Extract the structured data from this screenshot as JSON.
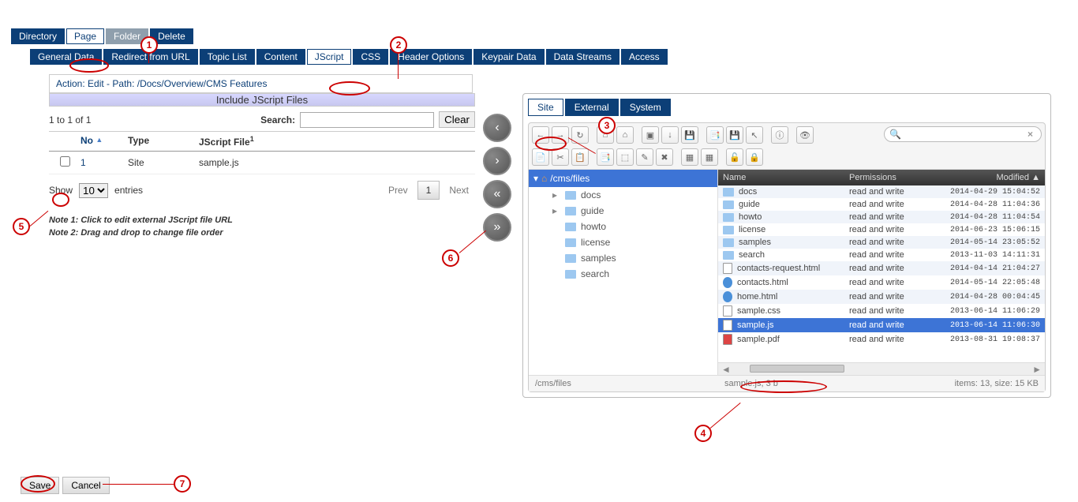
{
  "top_tabs": {
    "directory": "Directory",
    "page": "Page",
    "folder": "Folder",
    "delete": "Delete"
  },
  "sub_tabs": [
    "General Data",
    "Redirect from URL",
    "Topic List",
    "Content",
    "JScript",
    "CSS",
    "Header Options",
    "Keypair Data",
    "Data Streams",
    "Access"
  ],
  "sub_tab_selected": 4,
  "action_bar": {
    "prefix": "Action: ",
    "action": "Edit",
    "sep": " - ",
    "path_label": "Path: ",
    "path": "/Docs/Overview/CMS Features"
  },
  "section_title": "Include JScript Files",
  "search": {
    "count": "1 to 1 of 1",
    "label": "Search:",
    "value": "",
    "clear": "Clear"
  },
  "grid": {
    "headers": {
      "no": "No",
      "type": "Type",
      "file": "JScript File",
      "file_sup": "1"
    },
    "rows": [
      {
        "no": "1",
        "type": "Site",
        "file": "sample.js",
        "checked": false
      }
    ]
  },
  "pager": {
    "show": "Show",
    "entries": "entries",
    "size": "10",
    "prev": "Prev",
    "page": "1",
    "next": "Next"
  },
  "notes": {
    "n1": "Note 1: Click to edit external JScript file URL",
    "n2": "Note 2: Drag and drop to change file order"
  },
  "rp_tabs": [
    "Site",
    "External",
    "System"
  ],
  "rp_tab_selected": 0,
  "fm": {
    "root": "/cms/files",
    "tree": [
      {
        "label": "docs",
        "expandable": true
      },
      {
        "label": "guide",
        "expandable": true
      },
      {
        "label": "howto",
        "expandable": false
      },
      {
        "label": "license",
        "expandable": false
      },
      {
        "label": "samples",
        "expandable": false
      },
      {
        "label": "search",
        "expandable": false
      }
    ],
    "list_headers": {
      "name": "Name",
      "perm": "Permissions",
      "mod": "Modified"
    },
    "files": [
      {
        "name": "docs",
        "perm": "read and write",
        "mod": "2014-04-29 15:04:52",
        "type": "folder"
      },
      {
        "name": "guide",
        "perm": "read and write",
        "mod": "2014-04-28 11:04:36",
        "type": "folder"
      },
      {
        "name": "howto",
        "perm": "read and write",
        "mod": "2014-04-28 11:04:54",
        "type": "folder"
      },
      {
        "name": "license",
        "perm": "read and write",
        "mod": "2014-06-23 15:06:15",
        "type": "folder"
      },
      {
        "name": "samples",
        "perm": "read and write",
        "mod": "2014-05-14 23:05:52",
        "type": "folder"
      },
      {
        "name": "search",
        "perm": "read and write",
        "mod": "2013-11-03 14:11:31",
        "type": "folder"
      },
      {
        "name": "contacts-request.html",
        "perm": "read and write",
        "mod": "2014-04-14 21:04:27",
        "type": "file"
      },
      {
        "name": "contacts.html",
        "perm": "read and write",
        "mod": "2014-05-14 22:05:48",
        "type": "globe"
      },
      {
        "name": "home.html",
        "perm": "read and write",
        "mod": "2014-04-28 00:04:45",
        "type": "globe"
      },
      {
        "name": "sample.css",
        "perm": "read and write",
        "mod": "2013-06-14 11:06:29",
        "type": "file"
      },
      {
        "name": "sample.js",
        "perm": "read and write",
        "mod": "2013-06-14 11:06:30",
        "type": "file",
        "selected": true
      },
      {
        "name": "sample.pdf",
        "perm": "read and write",
        "mod": "2013-08-31 19:08:37",
        "type": "pdf"
      }
    ],
    "status": {
      "left": "/cms/files",
      "mid": "sample.js, 3 b",
      "right": "items: 13, size: 15 KB"
    },
    "search_placeholder": ""
  },
  "bottom": {
    "save": "Save",
    "cancel": "Cancel"
  },
  "toolbar_icons": [
    "←",
    "→",
    "↻",
    "⌂",
    "⌂",
    "▣",
    "↓",
    "💾",
    "📑",
    "💾",
    "↖",
    "ⓘ",
    "👁",
    "",
    "📄",
    "✂",
    "📋",
    "",
    "📑",
    "⬚",
    "✎",
    "✖",
    "",
    "▦",
    "▦",
    "",
    "🔓",
    "🔒"
  ]
}
